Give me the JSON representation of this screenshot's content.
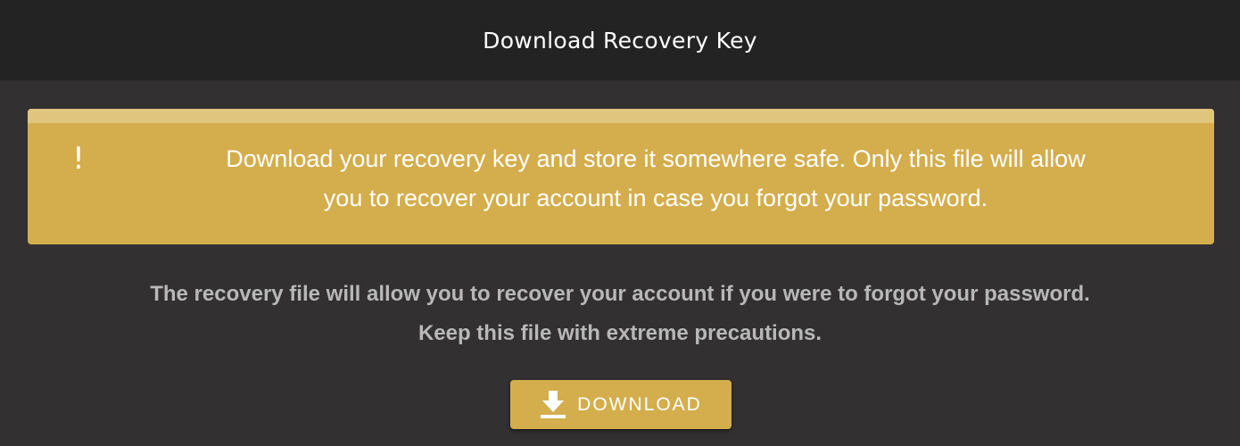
{
  "header": {
    "title": "Download Recovery Key"
  },
  "warning": {
    "icon": "exclamation-icon",
    "icon_glyph": "!",
    "line1": "Download your recovery key and store it somewhere safe. Only this file will allow",
    "line2": "you to recover your account in case you forgot your password.",
    "background_color": "#d4ae4d"
  },
  "info": {
    "line1": "The recovery file will allow you to recover your account if you were to forgot your password.",
    "line2": "Keep this file with extreme precautions."
  },
  "download_button": {
    "label": "DOWNLOAD",
    "icon": "download-icon",
    "color": "#d4ae4d"
  }
}
